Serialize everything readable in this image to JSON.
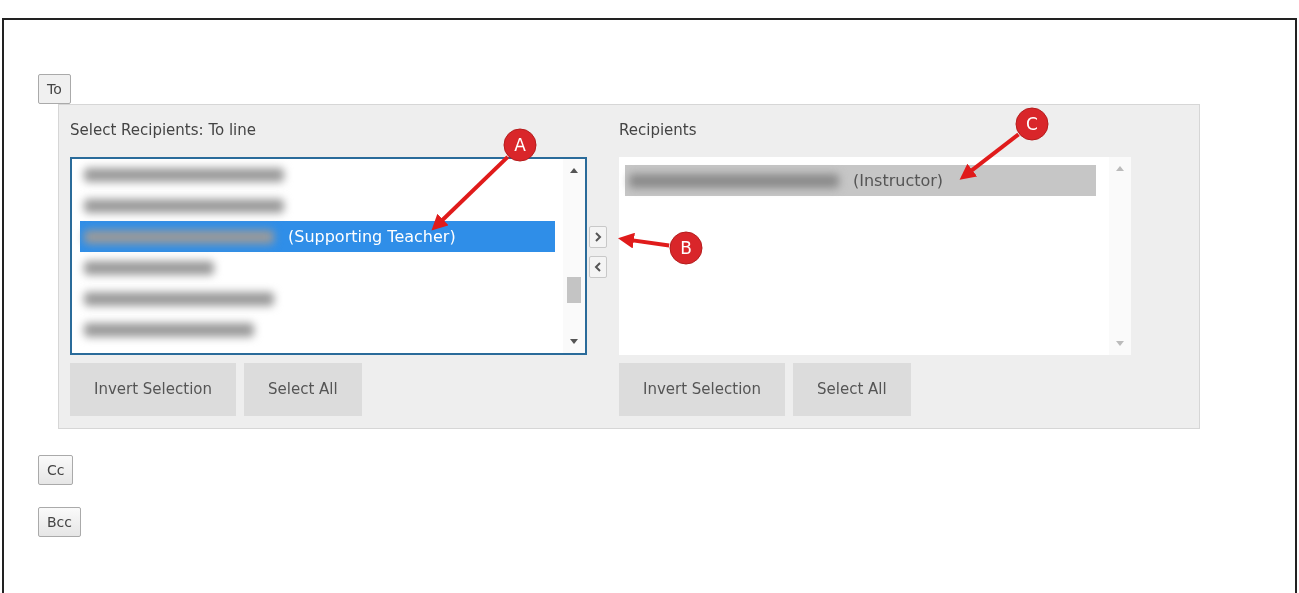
{
  "sections": [
    {
      "label": "To",
      "expanded": true
    },
    {
      "label": "Cc",
      "expanded": false
    },
    {
      "label": "Bcc",
      "expanded": false
    }
  ],
  "source_list": {
    "title": "Select Recipients: To line",
    "items": [
      {
        "selected": false
      },
      {
        "selected": false
      },
      {
        "role": "(Supporting Teacher)",
        "selected": true
      },
      {
        "selected": false
      },
      {
        "selected": false
      },
      {
        "selected": false
      }
    ],
    "actions": [
      "Invert Selection",
      "Select All"
    ]
  },
  "recipients_list": {
    "title": "Recipients",
    "items": [
      {
        "role": "(Instructor)",
        "selected": true
      }
    ],
    "actions": [
      "Invert Selection",
      "Select All"
    ]
  },
  "annotations": [
    {
      "label": "A"
    },
    {
      "label": "B"
    },
    {
      "label": "C"
    }
  ]
}
